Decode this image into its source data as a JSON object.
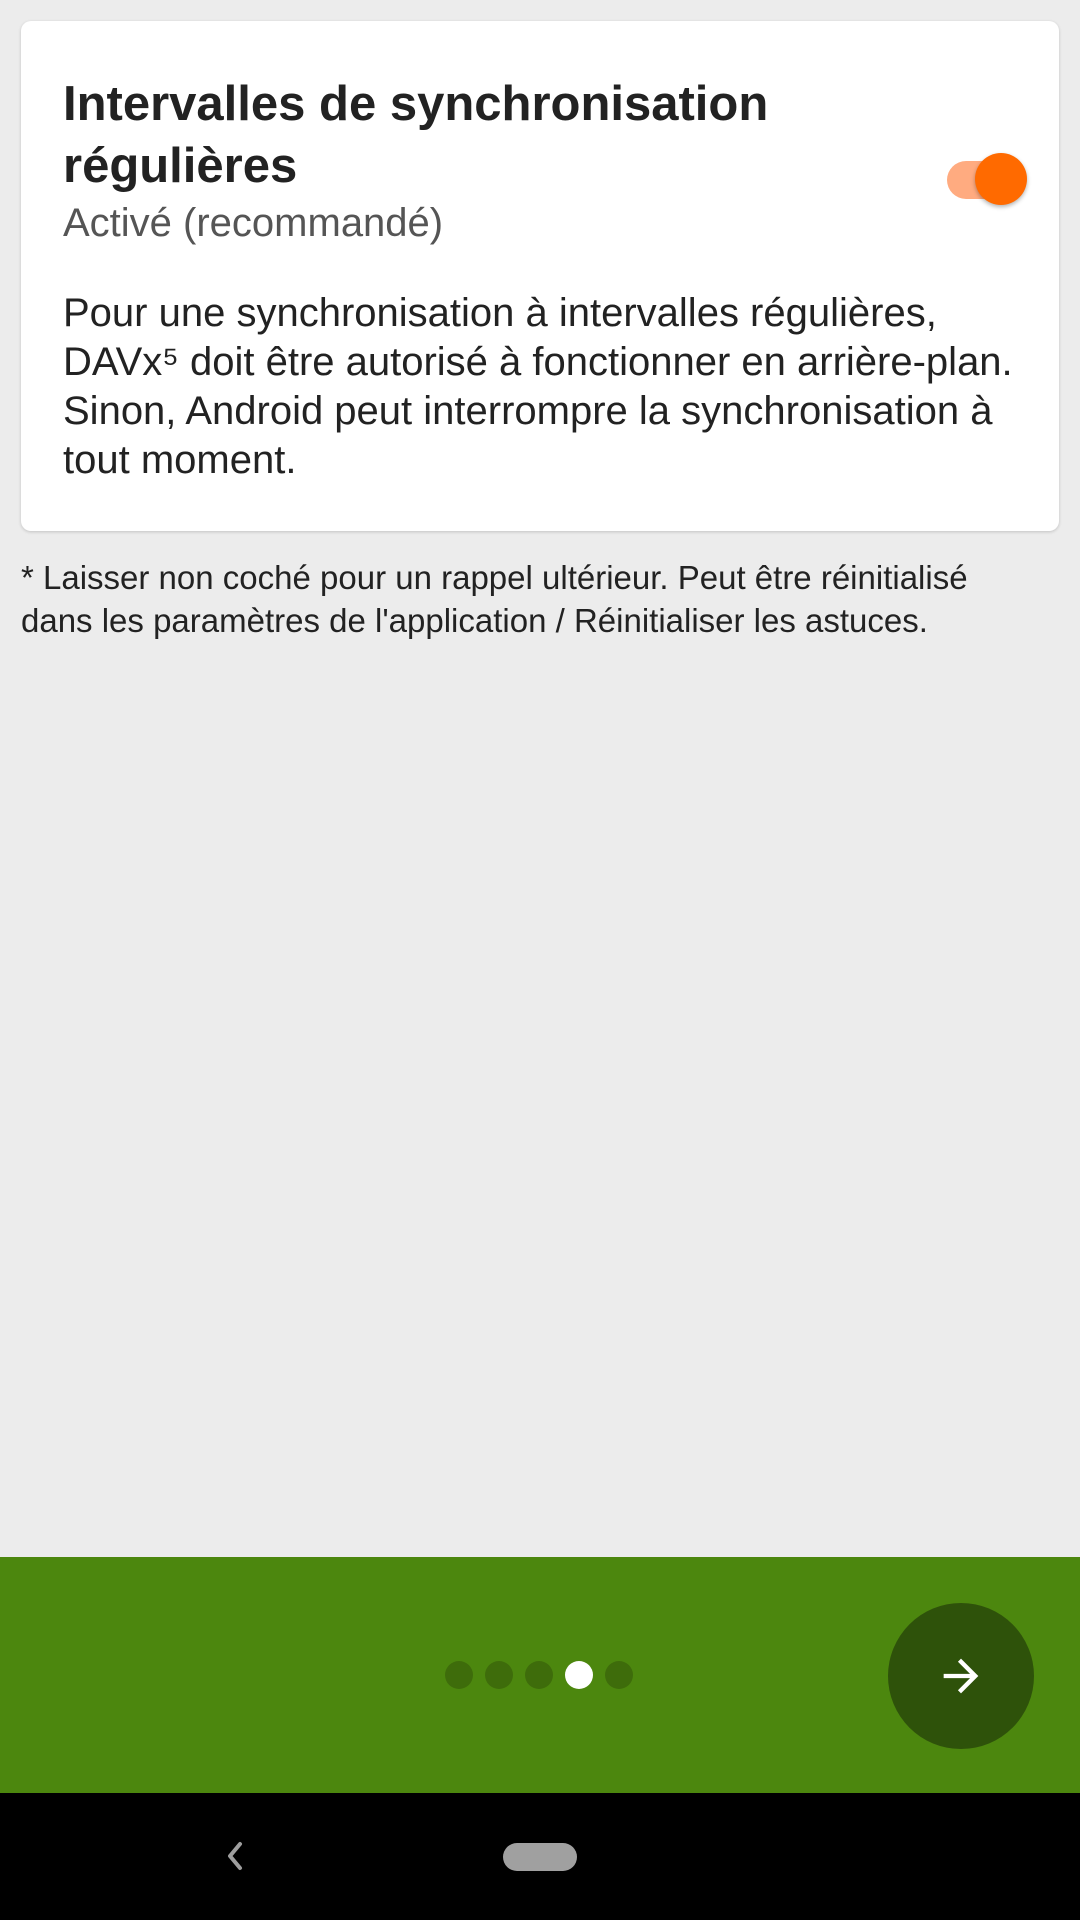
{
  "card": {
    "title": "Intervalles de synchronisation régulières",
    "status": "Activé (recommandé)",
    "description": "Pour une synchronisation à intervalles régulières, DAVx⁵ doit être autorisé à fonctionner en arrière-plan. Sinon, Android peut interrompre la synchronisation à tout moment.",
    "toggle_on": true
  },
  "footnote": "* Laisser non coché pour un rappel ultérieur. Peut être réinitialisé dans les paramètres de l'application / Réinitialiser les astuces.",
  "pager": {
    "total_pages": 5,
    "active_page": 4
  },
  "icons": {
    "next": "arrow-right-icon",
    "back": "chevron-left-icon",
    "home": "home-pill-icon"
  },
  "colors": {
    "accent": "#ff6a00",
    "accent_track": "#ffab80",
    "bottom_bar": "#4c870e",
    "fab": "#2e520a",
    "dot_inactive": "#3e6c0b",
    "dot_active": "#ffffff",
    "background": "#ececec"
  }
}
